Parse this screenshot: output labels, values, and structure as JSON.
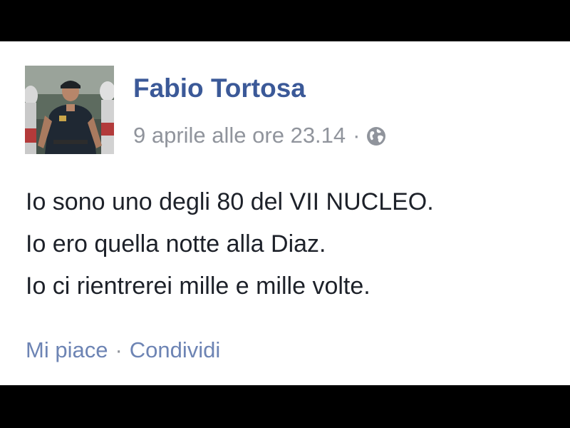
{
  "colors": {
    "background_bars": "#000000",
    "post_background": "#ffffff",
    "author_link": "#3b5998",
    "meta_text": "#90949c",
    "body_text": "#1d2129",
    "action_link": "#6d84b4",
    "action_separator": "#90949c"
  },
  "post": {
    "author_name": "Fabio Tortosa",
    "timestamp": "9 aprile alle ore 23.14",
    "meta_separator": "·",
    "privacy_icon": "globe-icon",
    "lines": [
      "Io sono uno degli 80 del VII NUCLEO.",
      "Io ero quella notte alla Diaz.",
      "Io ci rientrerei mille e mille volte."
    ]
  },
  "actions": {
    "like_label": "Mi piace",
    "separator": "·",
    "share_label": "Condividi"
  }
}
